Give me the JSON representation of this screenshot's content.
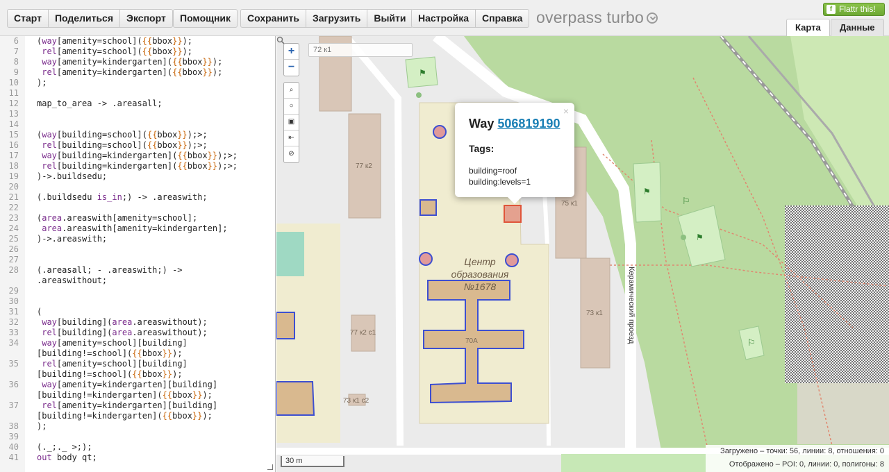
{
  "toolbar": {
    "group1": [
      "Старт",
      "Поделиться",
      "Экспорт"
    ],
    "group2": [
      "Помощник"
    ],
    "group3": [
      "Сохранить",
      "Загрузить",
      "Выйти"
    ],
    "group4": [
      "Настройка",
      "Справка"
    ],
    "brand": "overpass turbo",
    "flattr": "Flattr this!",
    "tabs": [
      "Карта",
      "Данные"
    ]
  },
  "editor": {
    "lines": [
      {
        "n": "6",
        "code": "(way[amenity=school]({{bbox}});"
      },
      {
        "n": "7",
        "code": " rel[amenity=school]({{bbox}});"
      },
      {
        "n": "8",
        "code": " way[amenity=kindergarten]({{bbox}});"
      },
      {
        "n": "9",
        "code": " rel[amenity=kindergarten]({{bbox}});"
      },
      {
        "n": "10",
        "code": ");"
      },
      {
        "n": "11",
        "code": ""
      },
      {
        "n": "12",
        "code": "map_to_area -> .areasall;"
      },
      {
        "n": "13",
        "code": ""
      },
      {
        "n": "14",
        "code": ""
      },
      {
        "n": "15",
        "code": "(way[building=school]({{bbox}});>;"
      },
      {
        "n": "16",
        "code": " rel[building=school]({{bbox}});>;"
      },
      {
        "n": "17",
        "code": " way[building=kindergarten]({{bbox}});>;"
      },
      {
        "n": "18",
        "code": " rel[building=kindergarten]({{bbox}});>;"
      },
      {
        "n": "19",
        "code": ")->.buildsedu;"
      },
      {
        "n": "20",
        "code": ""
      },
      {
        "n": "21",
        "code": "(.buildsedu is_in;) -> .areaswith;"
      },
      {
        "n": "22",
        "code": ""
      },
      {
        "n": "23",
        "code": "(area.areaswith[amenity=school];"
      },
      {
        "n": "24",
        "code": " area.areaswith[amenity=kindergarten];"
      },
      {
        "n": "25",
        "code": ")->.areaswith;"
      },
      {
        "n": "26",
        "code": ""
      },
      {
        "n": "27",
        "code": ""
      },
      {
        "n": "28",
        "code": "(.areasall; - .areaswith;) ->",
        "cont": ".areaswithout;"
      },
      {
        "n": "29",
        "code": ""
      },
      {
        "n": "30",
        "code": ""
      },
      {
        "n": "31",
        "code": "("
      },
      {
        "n": "32",
        "code": " way[building](area.areaswithout);"
      },
      {
        "n": "33",
        "code": " rel[building](area.areaswithout);"
      },
      {
        "n": "34",
        "code": " way[amenity=school][building]",
        "cont": "[building!=school]({{bbox}});"
      },
      {
        "n": "35",
        "code": " rel[amenity=school][building]",
        "cont": "[building!=school]({{bbox}});"
      },
      {
        "n": "36",
        "code": " way[amenity=kindergarten][building]",
        "cont": "[building!=kindergarten]({{bbox}});"
      },
      {
        "n": "37",
        "code": " rel[amenity=kindergarten][building]",
        "cont": "[building!=kindergarten]({{bbox}});"
      },
      {
        "n": "38",
        "code": ");"
      },
      {
        "n": "39",
        "code": ""
      },
      {
        "n": "40",
        "code": "(._;._ >;);"
      },
      {
        "n": "41",
        "code": "out body qt;"
      }
    ]
  },
  "map": {
    "search_placeholder": "72 к1",
    "controls_zoom": [
      "+",
      "−"
    ],
    "controls_tools": [
      "⌕",
      "○",
      "▣",
      "⇤",
      "⊘"
    ],
    "house_labels": [
      "77 к2",
      "75 к1",
      "73 к1",
      "77 к2 с1",
      "73 к1 с2",
      "70А"
    ],
    "poi_label": "Центр образования №1678",
    "road_label": "Керамический проезд",
    "scale": "30 m",
    "stats_loaded": "Загружено – точки: 56, линии: 8, отношения: 0",
    "stats_shown": "Отображено – POI: 0, линии: 0, полигоны: 8"
  },
  "popup": {
    "title_prefix": "Way",
    "id": "506819190",
    "tags_heading": "Tags:",
    "tags": [
      "building=roof",
      "building:levels=1"
    ],
    "close": "×"
  },
  "colors": {
    "building": "#d9c6b7",
    "school_area": "#f0ecd0",
    "park": "#b7d99b",
    "highlight": "#3d4fd1",
    "selected": "#e0553a",
    "link": "#1a7fb5"
  }
}
